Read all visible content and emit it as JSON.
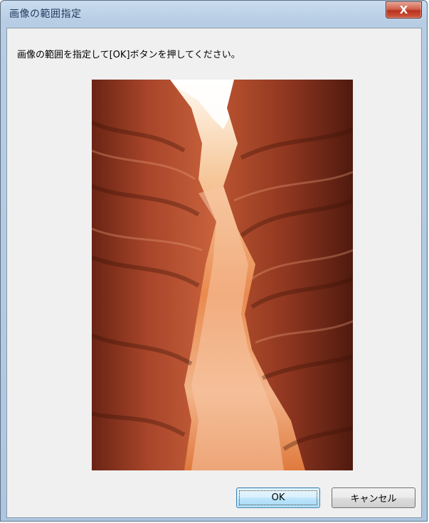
{
  "window": {
    "title": "画像の範囲指定",
    "close_label": "X"
  },
  "dialog": {
    "instruction": "画像の範囲を指定して[OK]ボタンを押してください。"
  },
  "image": {
    "subject": "slot canyon photo"
  },
  "buttons": {
    "ok_label": "OK",
    "cancel_label": "キャンセル"
  },
  "colors": {
    "titlebar": "#b7cde4",
    "client": "#f0f0f0",
    "close_button": "#c7432d",
    "ok_button_border": "#3c7fb1"
  }
}
